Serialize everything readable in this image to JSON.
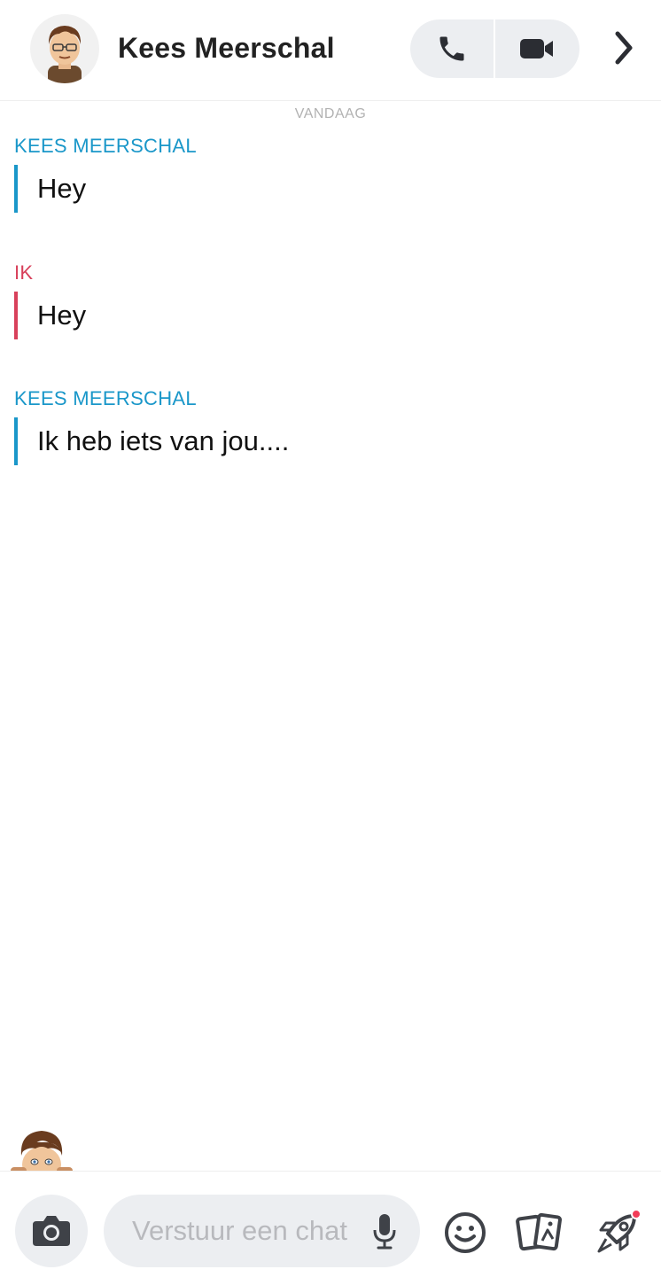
{
  "header": {
    "contact_name": "Kees Meerschal",
    "avatar_icon": "bitmoji-avatar-icon",
    "voice_call_icon": "phone-icon",
    "video_call_icon": "video-camera-icon",
    "more_icon": "chevron-right-icon"
  },
  "chat": {
    "date_separator": "VANDAAG",
    "messages": [
      {
        "sender": "KEES MEERSCHAL",
        "text": "Hey",
        "from_me": false
      },
      {
        "sender": "IK",
        "text": "Hey",
        "from_me": true
      },
      {
        "sender": "KEES MEERSCHAL",
        "text": "Ik heb iets van jou....",
        "from_me": false
      }
    ]
  },
  "composer": {
    "placeholder": "Verstuur een chat",
    "camera_icon": "camera-icon",
    "mic_icon": "microphone-icon",
    "emoji_icon": "smiley-icon",
    "cards_icon": "cards-icon",
    "games_icon": "rocket-icon",
    "games_has_notification": true
  },
  "colors": {
    "them": "#1a97c9",
    "me": "#d8405b",
    "pill_bg": "#eceef1",
    "icon": "#2b2d33",
    "notification": "#f23c57"
  }
}
